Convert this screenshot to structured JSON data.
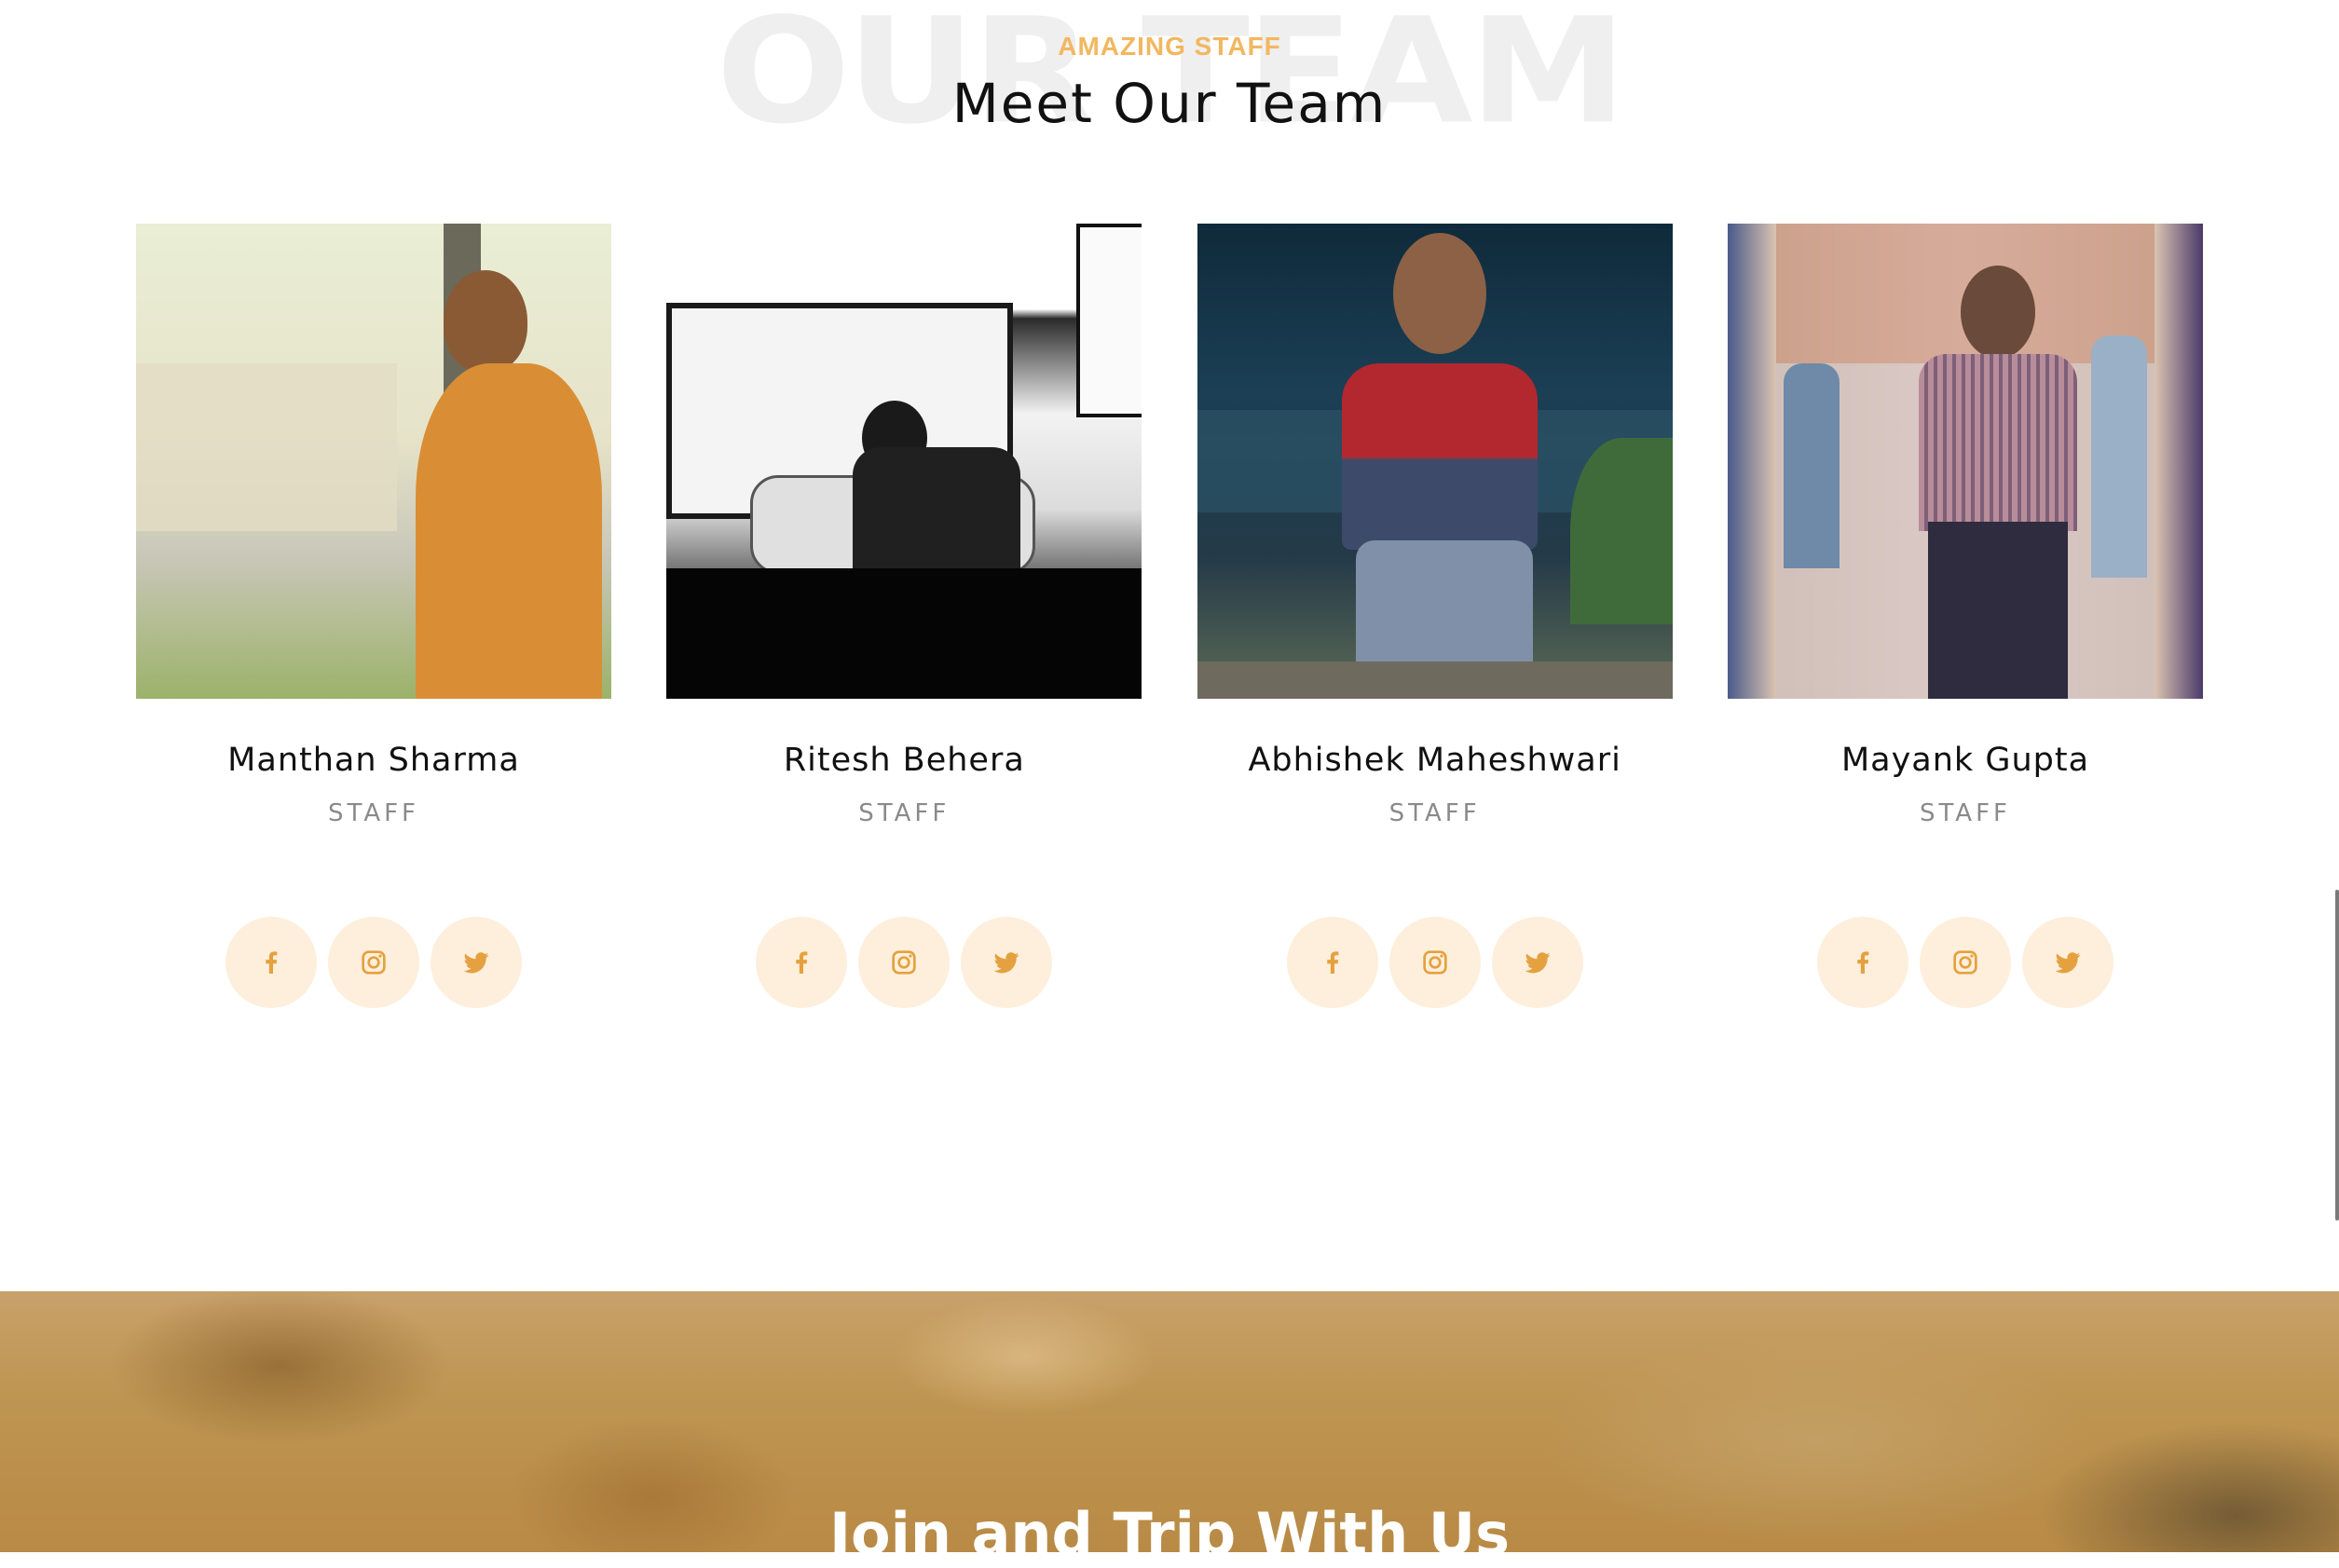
{
  "section": {
    "watermark": "OUR TEAM",
    "eyebrow": "AMAZING STAFF",
    "title": "Meet Our Team"
  },
  "colors": {
    "accent": "#f2b760",
    "social_bg": "#fdefdc",
    "watermark": "#efefef",
    "role_text": "#8a8a8a"
  },
  "team": [
    {
      "name": "Manthan Sharma",
      "role": "STAFF",
      "photo": "photo"
    },
    {
      "name": "Ritesh Behera",
      "role": "STAFF",
      "photo": "photo"
    },
    {
      "name": "Abhishek Maheshwari",
      "role": "STAFF",
      "photo": "photo"
    },
    {
      "name": "Mayank Gupta",
      "role": "STAFF",
      "photo": "photo"
    }
  ],
  "social_icons": [
    "facebook-icon",
    "instagram-icon",
    "twitter-icon"
  ],
  "banner": {
    "title": "Join and Trip With Us"
  }
}
